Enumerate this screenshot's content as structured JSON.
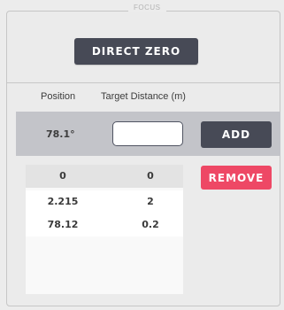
{
  "panel": {
    "legend": "FOCUS",
    "direct_zero_label": "DIRECT ZERO"
  },
  "columns": {
    "position": "Position",
    "target_distance": "Target Distance (m)"
  },
  "input_row": {
    "position_value": "78.1°",
    "distance_value": "",
    "add_label": "ADD"
  },
  "remove_label": "REMOVE",
  "table": {
    "rows": [
      {
        "position": "0",
        "distance": "0",
        "selected": true
      },
      {
        "position": "2.215",
        "distance": "2",
        "selected": false
      },
      {
        "position": "78.12",
        "distance": "0.2",
        "selected": false
      }
    ]
  }
}
